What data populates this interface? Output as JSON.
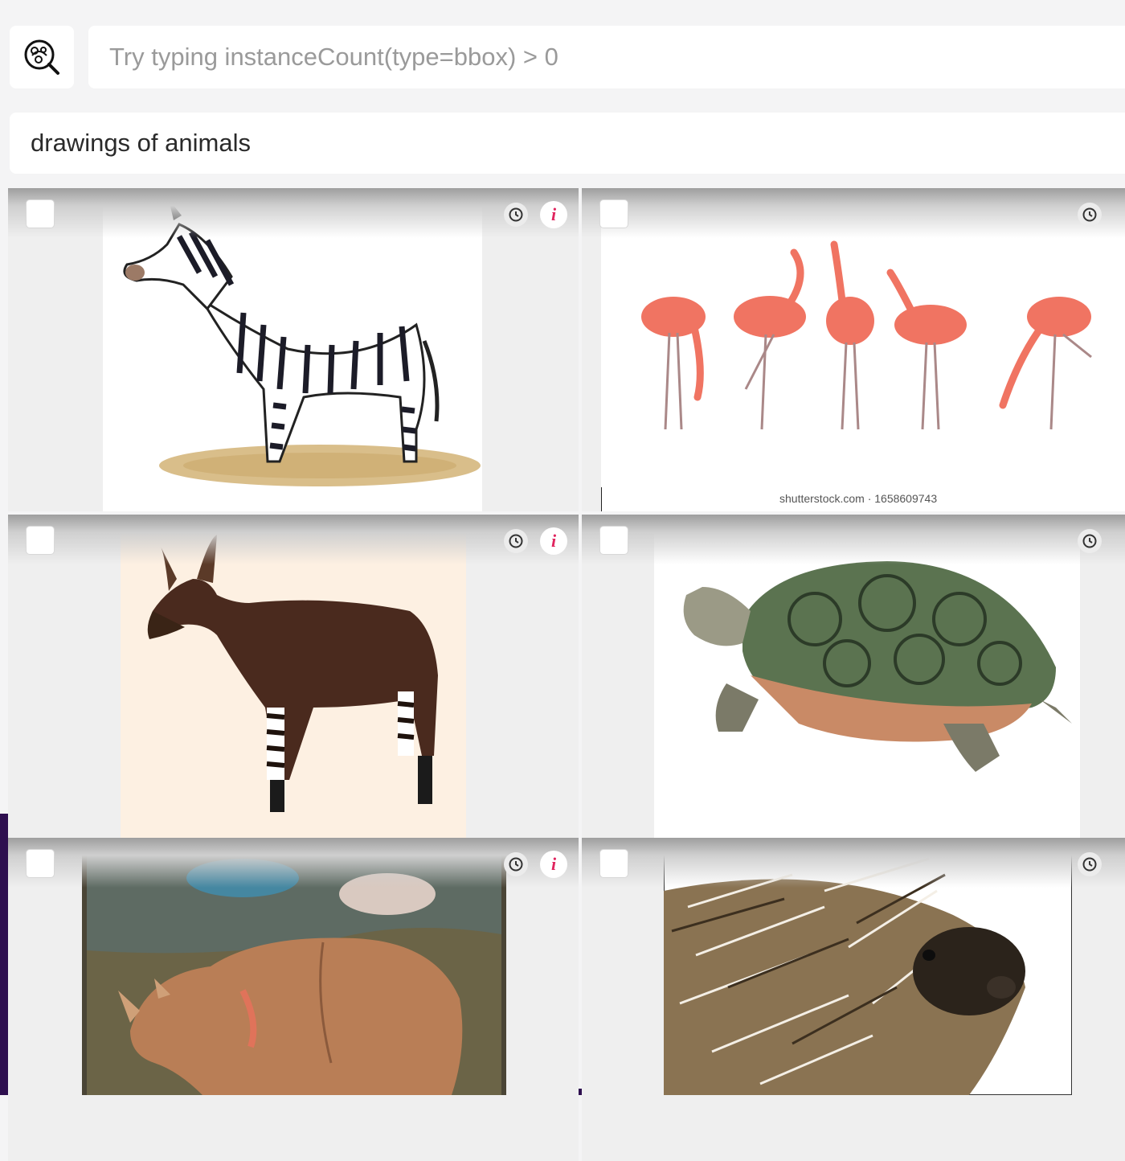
{
  "search": {
    "query_placeholder": "Try typing instanceCount(type=bbox) > 0",
    "query_value": "",
    "text_query": "drawings of animals"
  },
  "grid": {
    "tiles": [
      {
        "subject": "zebra",
        "has_info": true
      },
      {
        "subject": "flamingos",
        "has_info": false,
        "watermark": "shutterstock.com · 1658609743"
      },
      {
        "subject": "okapi",
        "has_info": true
      },
      {
        "subject": "turtle",
        "has_info": false
      },
      {
        "subject": "rhinoceros",
        "has_info": true
      },
      {
        "subject": "porcupine",
        "has_info": false
      }
    ]
  },
  "icons": {
    "search": "lens-search-icon",
    "timestamp": "clock-icon",
    "info": "info-icon"
  },
  "colors": {
    "accent": "#e0245e",
    "frame": "#2e0f4f"
  }
}
